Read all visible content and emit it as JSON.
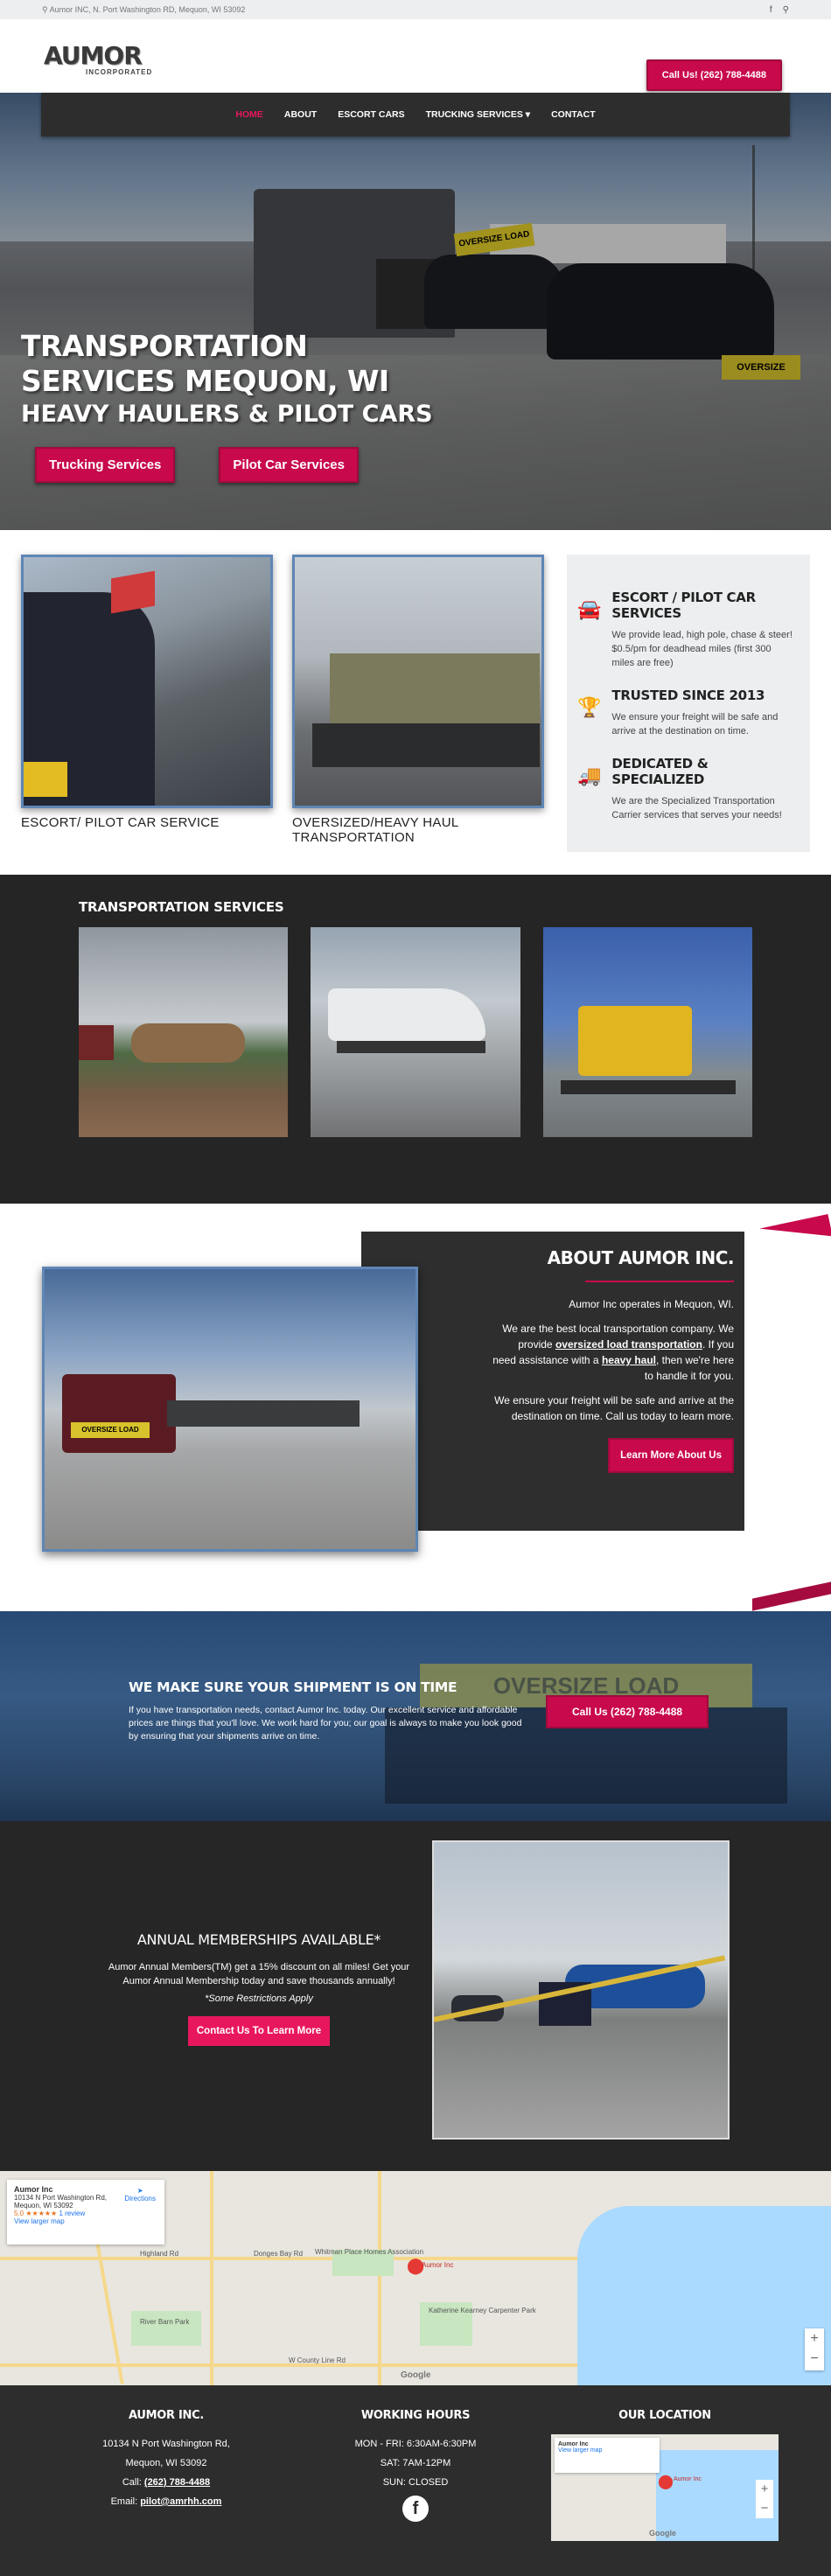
{
  "topbar": {
    "address_icon": "map-pin-icon",
    "address": "Aumor INC, N. Port Washington RD, Mequon, WI 53092",
    "social": [
      {
        "icon": "facebook-icon",
        "glyph": "f"
      },
      {
        "icon": "map-pin-icon",
        "glyph": "⚲"
      }
    ]
  },
  "header": {
    "logo_main": "AUMOR",
    "logo_sub": "INCORPORATED",
    "call_label": "Call Us! (262) 788-4488"
  },
  "nav": {
    "items": [
      {
        "label": "Home",
        "active": true
      },
      {
        "label": "About",
        "active": false
      },
      {
        "label": "Escort Cars",
        "active": false
      },
      {
        "label": "Trucking Services ▾",
        "active": false
      },
      {
        "label": "Contact",
        "active": false
      }
    ]
  },
  "hero": {
    "title_line1": "Transportation",
    "title_line2": "Services Mequon, WI",
    "subtitle": "Heavy Haulers & Pilot Cars",
    "btn_trucking": "Trucking Services",
    "btn_pilot": "Pilot Car Services",
    "sign1": "OVERSIZE LOAD",
    "sign2": "OVERSIZE"
  },
  "highlights": {
    "photo1_caption": "Escort/ Pilot Car Service",
    "photo2_caption": "Oversized/Heavy Haul Transportation",
    "items": [
      {
        "icon": "car-icon",
        "glyph": "🚘",
        "title": "Escort / Pilot Car Services",
        "text": "We provide lead, high pole, chase & steer! $0.5/pm for deadhead miles (first 300 miles are free)"
      },
      {
        "icon": "trophy-icon",
        "glyph": "🏆",
        "title": "Trusted Since 2013",
        "text": "We ensure your freight will be safe and arrive at the destination on time."
      },
      {
        "icon": "truck-icon",
        "glyph": "🚚",
        "title": "Dedicated & Specialized",
        "text": "We are the Specialized Transportation Carrier services that serves your needs!"
      }
    ]
  },
  "services": {
    "heading": "Transportation Services"
  },
  "about": {
    "heading": "About Aumor Inc.",
    "p1": "Aumor Inc operates in Mequon, WI.",
    "p2_a": "We are the best local transportation company. We provide ",
    "p2_link1": "oversized load transportation",
    "p2_b": ". If you need assistance with a ",
    "p2_link2": "heavy haul",
    "p2_c": ", then we're here to handle it for you.",
    "p3": "We ensure your freight will be safe and arrive at the destination on time. Call us today to learn more.",
    "btn": "Learn More About Us",
    "truck_sign": "OVERSIZE LOAD"
  },
  "shipment": {
    "heading": "We Make Sure Your Shipment Is On Time",
    "text": "If you have transportation needs, contact Aumor Inc. today. Our excellent service and affordable prices are things that you'll love. We work hard for you; our goal is always to make you look good by ensuring that your shipments arrive on time.",
    "btn": "Call Us (262) 788-4488",
    "bg_sign": "OVERSIZE LOAD"
  },
  "memberships": {
    "heading": "Annual Memberships Available*",
    "text": "Aumor Annual Members(TM) get a 15% discount on all miles! Get your Aumor Annual Membership today and save thousands annually!",
    "note": "*Some Restrictions Apply",
    "btn": "Contact Us To Learn More"
  },
  "map": {
    "card_title": "Aumor Inc",
    "card_address1": "10134 N Port Washington Rd,",
    "card_address2": "Mequon, WI 53092",
    "card_rating": "5.0 ★★★★★",
    "card_reviews": "1 review",
    "card_larger": "View larger map",
    "directions": "Directions",
    "pin_label": "Aumor Inc",
    "google": "Google",
    "zoom_in": "+",
    "zoom_out": "−",
    "place1": "Whitman Place Homes Association",
    "place2": "Katherine Kearney Carpenter Park",
    "place3": "River Barn Park",
    "road1": "Donges Bay Rd",
    "road2": "W County Line Rd",
    "road3": "Highland Rd"
  },
  "footer": {
    "col1_title": "Aumor Inc.",
    "address1": "10134 N Port Washington Rd,",
    "address2": "Mequon, WI 53092",
    "call_prefix": "Call: ",
    "phone": "(262) 788-4488",
    "email_prefix": "Email: ",
    "email": "pilot@amrhh.com",
    "col2_title": "Working Hours",
    "hours1": "MON - FRI: 6:30AM-6:30PM",
    "hours2": "SAT: 7AM-12PM",
    "hours3": "SUN: CLOSED",
    "fb_glyph": "f",
    "col3_title": "Our Location",
    "map_title": "Aumor Inc",
    "map_larger": "View larger map",
    "map_pin": "Aumor Inc",
    "map_google": "Google"
  }
}
